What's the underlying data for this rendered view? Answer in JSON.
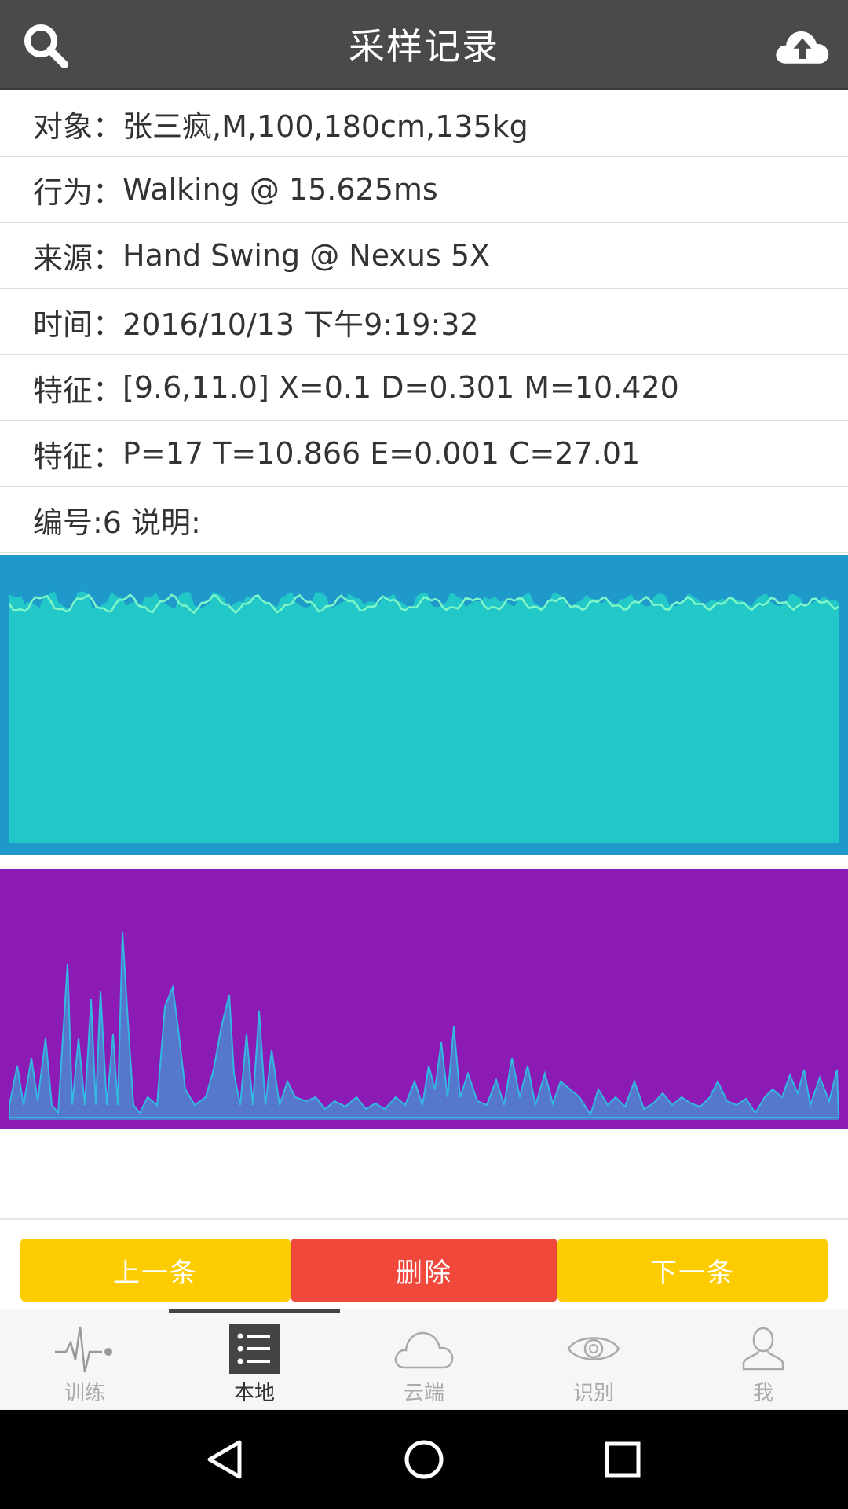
{
  "header": {
    "title": "采样记录",
    "search_icon": "search-icon",
    "upload_icon": "cloud-upload-icon"
  },
  "rows": [
    {
      "label": "对象：",
      "value": "张三疯,M,100,180cm,135kg"
    },
    {
      "label": "行为：",
      "value": "Walking @ 15.625ms"
    },
    {
      "label": "来源：",
      "value": "Hand Swing @ Nexus 5X"
    },
    {
      "label": "时间：",
      "value": "2016/10/13 下午9:19:32"
    },
    {
      "label": "特征：",
      "value": "[9.6,11.0] X=0.1 D=0.301 M=10.420"
    },
    {
      "label": "特征：",
      "value": "P=17 T=10.866 E=0.001 C=27.01"
    },
    {
      "label": "编号:6 说明:",
      "value": ""
    }
  ],
  "charts": {
    "colors": {
      "blue_bg": "#1f99c9",
      "blue_fill": "#22c7c7",
      "blue_line": "#7ff7c8",
      "purple_bg": "#8c1ab5",
      "purple_fill": "#5577cc",
      "purple_line": "#33b8e0"
    }
  },
  "actions": {
    "prev_label": "上一条",
    "delete_label": "删除",
    "next_label": "下一条",
    "colors": {
      "prev": "#fccb00",
      "delete": "#f0483a",
      "next": "#fccb00"
    }
  },
  "tabbar": {
    "active_index": 1,
    "tabs": [
      {
        "label": "训练",
        "icon": "pulse-icon"
      },
      {
        "label": "本地",
        "icon": "list-icon"
      },
      {
        "label": "云端",
        "icon": "cloud-icon"
      },
      {
        "label": "识别",
        "icon": "eye-icon"
      },
      {
        "label": "我",
        "icon": "user-icon"
      }
    ]
  },
  "system_nav": {
    "back_icon": "back-triangle-icon",
    "home_icon": "home-circle-icon",
    "recents_icon": "recents-square-icon"
  }
}
